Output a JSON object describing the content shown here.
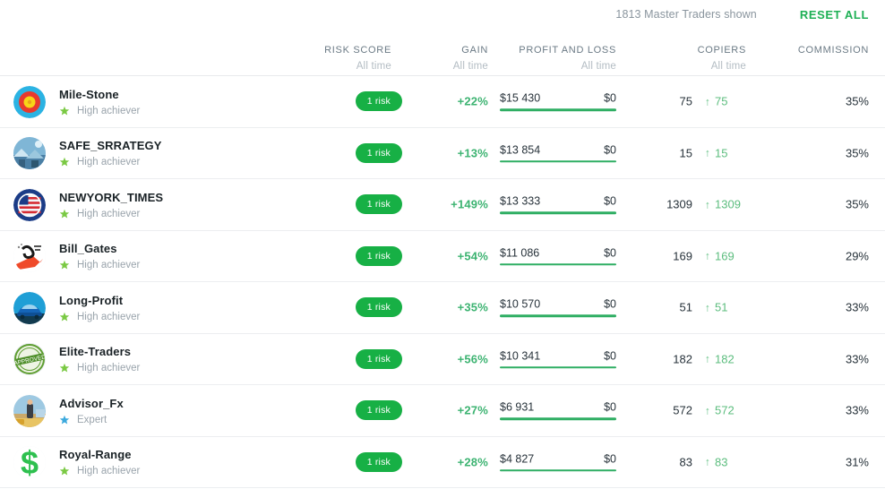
{
  "topbar": {
    "shown_count": "1813 Master Traders shown",
    "reset_label": "RESET ALL",
    "accent_color": "#1eb055"
  },
  "columns": {
    "risk_score": {
      "label": "RISK SCORE",
      "sub": "All time"
    },
    "gain": {
      "label": "GAIN",
      "sub": "All time"
    },
    "profit_and_loss": {
      "label": "PROFIT AND LOSS",
      "sub": "All time"
    },
    "copiers": {
      "label": "COPIERS",
      "sub": "All time"
    },
    "commission": {
      "label": "COMMISSION",
      "sub": ""
    }
  },
  "badges": {
    "high_achiever": "High achiever",
    "expert": "Expert",
    "high_achiever_color": "#7ac943",
    "expert_color": "#3ba9dd"
  },
  "colors": {
    "risk_pill_bg": "#17b045",
    "gain_green": "#3cb371",
    "bar_green": "#2fae63",
    "copier_green": "#5cbd7e"
  },
  "rows": [
    {
      "name": "Mile-Stone",
      "badge": "High achiever",
      "badge_type": "high_achiever",
      "avatar": "target-icon",
      "risk": "1 risk",
      "gain": "+22%",
      "profit": "$15 430",
      "loss": "$0",
      "copiers_total": "75",
      "copiers_delta": "75",
      "copiers_arrow": "↑",
      "commission": "35%"
    },
    {
      "name": "SAFE_SRRATEGY",
      "badge": "High achiever",
      "badge_type": "high_achiever",
      "avatar": "winter-photo-icon",
      "risk": "1 risk",
      "gain": "+13%",
      "profit": "$13 854",
      "loss": "$0",
      "copiers_total": "15",
      "copiers_delta": "15",
      "copiers_arrow": "↑",
      "commission": "35%"
    },
    {
      "name": "NEWYORK_TIMES",
      "badge": "High achiever",
      "badge_type": "high_achiever",
      "avatar": "us-flag-seal-icon",
      "risk": "1 risk",
      "gain": "+149%",
      "profit": "$13 333",
      "loss": "$0",
      "copiers_total": "1309",
      "copiers_delta": "1309",
      "copiers_arrow": "↑",
      "commission": "35%"
    },
    {
      "name": "Bill_Gates",
      "badge": "High achiever",
      "badge_type": "high_achiever",
      "avatar": "red-arrow-sketch-icon",
      "risk": "1 risk",
      "gain": "+54%",
      "profit": "$11 086",
      "loss": "$0",
      "copiers_total": "169",
      "copiers_delta": "169",
      "copiers_arrow": "↑",
      "commission": "29%"
    },
    {
      "name": "Long-Profit",
      "badge": "High achiever",
      "badge_type": "high_achiever",
      "avatar": "blue-car-icon",
      "risk": "1 risk",
      "gain": "+35%",
      "profit": "$10 570",
      "loss": "$0",
      "copiers_total": "51",
      "copiers_delta": "51",
      "copiers_arrow": "↑",
      "commission": "33%"
    },
    {
      "name": "Elite-Traders",
      "badge": "High achiever",
      "badge_type": "high_achiever",
      "avatar": "approved-stamp-icon",
      "risk": "1 risk",
      "gain": "+56%",
      "profit": "$10 341",
      "loss": "$0",
      "copiers_total": "182",
      "copiers_delta": "182",
      "copiers_arrow": "↑",
      "commission": "33%"
    },
    {
      "name": "Advisor_Fx",
      "badge": "Expert",
      "badge_type": "expert",
      "avatar": "person-photo-icon",
      "risk": "1 risk",
      "gain": "+27%",
      "profit": "$6 931",
      "loss": "$0",
      "copiers_total": "572",
      "copiers_delta": "572",
      "copiers_arrow": "↑",
      "commission": "33%"
    },
    {
      "name": "Royal-Range",
      "badge": "High achiever",
      "badge_type": "high_achiever",
      "avatar": "dollar-sign-icon",
      "risk": "1 risk",
      "gain": "+28%",
      "profit": "$4 827",
      "loss": "$0",
      "copiers_total": "83",
      "copiers_delta": "83",
      "copiers_arrow": "↑",
      "commission": "31%"
    }
  ]
}
